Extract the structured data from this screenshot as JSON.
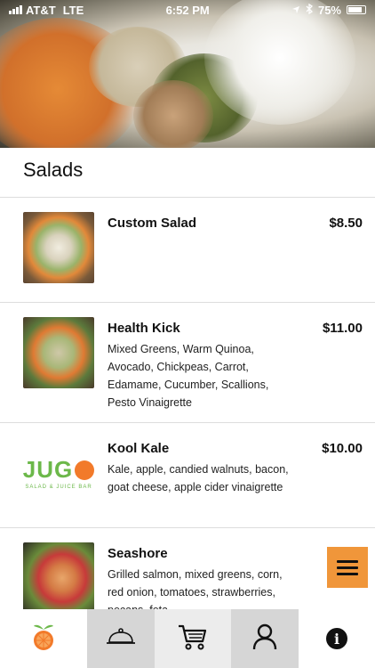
{
  "status_bar": {
    "carrier": "AT&T",
    "network": "LTE",
    "time": "6:52 PM",
    "battery": "75%"
  },
  "section": {
    "title": "Salads"
  },
  "menu_items": [
    {
      "name": "Custom Salad",
      "price": "$8.50",
      "description": "",
      "image": "salad-photo"
    },
    {
      "name": "Health Kick",
      "price": "$11.00",
      "description": "Mixed Greens, Warm Quinoa, Avocado, Chickpeas, Carrot, Edamame, Cucumber, Scallions, Pesto Vinaigrette",
      "image": "salad-photo"
    },
    {
      "name": "Kool Kale",
      "price": "$10.00",
      "description": "Kale, apple, candied walnuts, bacon, goat cheese, apple cider vinaigrette",
      "image": "jugo-logo"
    },
    {
      "name": "Seashore",
      "price": "$",
      "description": "Grilled salmon, mixed greens, corn, red onion, tomatoes, strawberries, pecans, feta",
      "image": "salad-photo"
    }
  ],
  "logo": {
    "word_prefix": "JUG",
    "subtitle": "SALAD & JUICE BAR"
  },
  "nav": {
    "items": [
      "logo-icon",
      "cloche-icon",
      "cart-icon",
      "person-icon",
      "info-icon"
    ],
    "info_glyph": "i"
  },
  "colors": {
    "accent": "#f0963a",
    "logo_green": "#6cb84a",
    "logo_orange": "#f27a2a",
    "nav_active": "#d6d6d6"
  }
}
